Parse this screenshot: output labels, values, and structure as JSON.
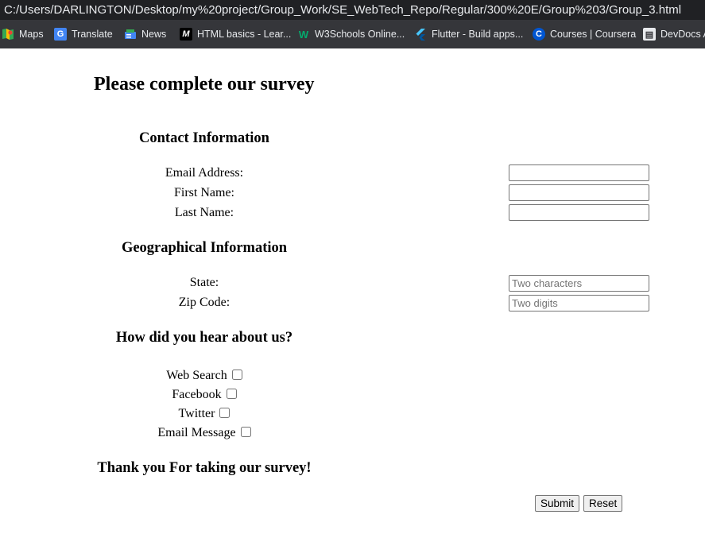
{
  "browser": {
    "url": "C:/Users/DARLINGTON/Desktop/my%20project/Group_Work/SE_WebTech_Repo/Regular/300%20E/Group%203/Group_3.html",
    "bookmarks": [
      {
        "label": "Maps",
        "icon": "maps-icon"
      },
      {
        "label": "Translate",
        "icon": "translate-icon"
      },
      {
        "label": "News",
        "icon": "news-icon"
      },
      {
        "label": "HTML basics - Lear...",
        "icon": "mdn-icon"
      },
      {
        "label": "W3Schools Online...",
        "icon": "w3schools-icon"
      },
      {
        "label": "Flutter - Build apps...",
        "icon": "flutter-icon"
      },
      {
        "label": "Courses | Coursera",
        "icon": "coursera-icon"
      },
      {
        "label": "DevDocs A",
        "icon": "devdocs-icon"
      }
    ]
  },
  "page": {
    "title": "Please complete our survey",
    "contact": {
      "heading": "Contact Information",
      "email_label": "Email Address:",
      "first_name_label": "First Name:",
      "last_name_label": "Last Name:",
      "email_value": "",
      "first_name_value": "",
      "last_name_value": ""
    },
    "geo": {
      "heading": "Geographical Information",
      "state_label": "State:",
      "state_placeholder": "Two characters",
      "zip_label": "Zip Code:",
      "zip_placeholder": "Two digits"
    },
    "hear": {
      "heading": "How did you hear about us?",
      "options": [
        "Web Search",
        "Facebook",
        "Twitter",
        "Email Message"
      ]
    },
    "thanks": "Thank you For taking our survey!",
    "buttons": {
      "submit": "Submit",
      "reset": "Reset"
    }
  }
}
